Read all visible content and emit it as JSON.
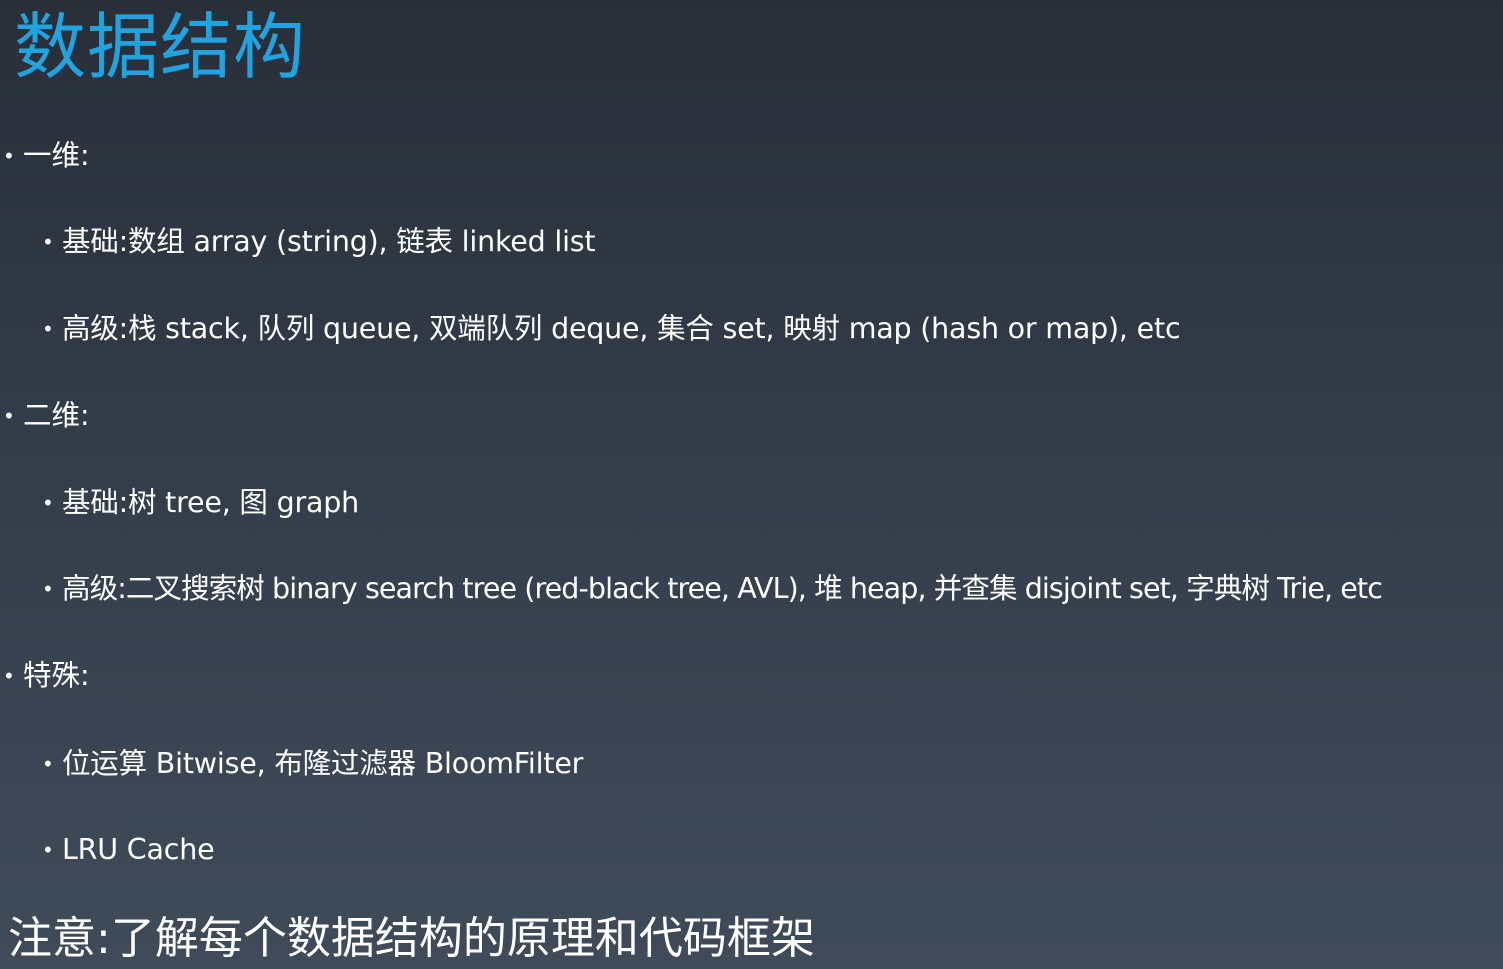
{
  "title": "数据结构",
  "bullet_char": "•",
  "sections": [
    {
      "label": "一维:",
      "items": [
        "基础:数组 array (string), 链表 linked list",
        "高级:栈 stack, 队列 queue, 双端队列 deque, 集合 set, 映射 map (hash or map), etc"
      ]
    },
    {
      "label": "二维:",
      "items": [
        "基础:树 tree, 图 graph",
        "高级:二叉搜索树 binary search tree (red-black tree, AVL), 堆 heap, 并查集 disjoint set, 字典树 Trie, etc"
      ]
    },
    {
      "label": "特殊:",
      "items": [
        "位运算 Bitwise, 布隆过滤器 BloomFilter",
        "LRU Cache"
      ]
    }
  ],
  "note": "注意:了解每个数据结构的原理和代码框架"
}
